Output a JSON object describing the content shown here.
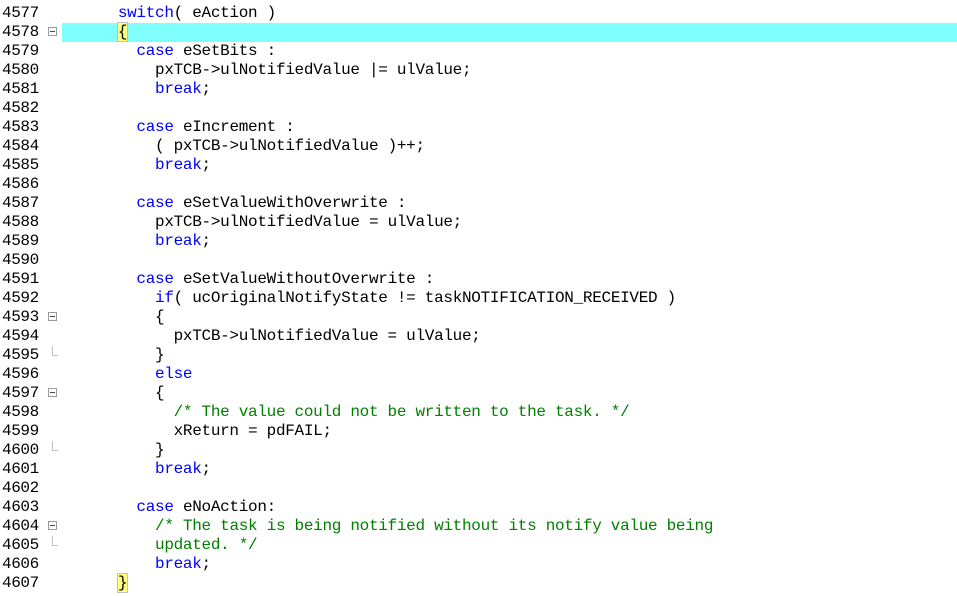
{
  "editor": {
    "highlight_color": "#80ffff",
    "lines": [
      {
        "num": "4577",
        "indent": "      ",
        "parts": [
          [
            "kw",
            "switch"
          ],
          [
            "",
            "( eAction )"
          ]
        ],
        "fold": "line"
      },
      {
        "num": "4578",
        "indent": "      ",
        "parts": [
          [
            "brace",
            "{"
          ]
        ],
        "fold": "box",
        "highlight": true
      },
      {
        "num": "4579",
        "indent": "        ",
        "parts": [
          [
            "kw",
            "case"
          ],
          [
            "",
            " eSetBits :"
          ]
        ],
        "fold": "line"
      },
      {
        "num": "4580",
        "indent": "          ",
        "parts": [
          [
            "",
            "pxTCB->ulNotifiedValue |= ulValue;"
          ]
        ],
        "fold": "line"
      },
      {
        "num": "4581",
        "indent": "          ",
        "parts": [
          [
            "kw",
            "break"
          ],
          [
            "",
            ";"
          ]
        ],
        "fold": "line"
      },
      {
        "num": "4582",
        "indent": "",
        "parts": [],
        "fold": "line"
      },
      {
        "num": "4583",
        "indent": "        ",
        "parts": [
          [
            "kw",
            "case"
          ],
          [
            "",
            " eIncrement :"
          ]
        ],
        "fold": "line"
      },
      {
        "num": "4584",
        "indent": "          ",
        "parts": [
          [
            "",
            "( pxTCB->ulNotifiedValue )++;"
          ]
        ],
        "fold": "line"
      },
      {
        "num": "4585",
        "indent": "          ",
        "parts": [
          [
            "kw",
            "break"
          ],
          [
            "",
            ";"
          ]
        ],
        "fold": "line"
      },
      {
        "num": "4586",
        "indent": "",
        "parts": [],
        "fold": "line"
      },
      {
        "num": "4587",
        "indent": "        ",
        "parts": [
          [
            "kw",
            "case"
          ],
          [
            "",
            " eSetValueWithOverwrite :"
          ]
        ],
        "fold": "line"
      },
      {
        "num": "4588",
        "indent": "          ",
        "parts": [
          [
            "",
            "pxTCB->ulNotifiedValue = ulValue;"
          ]
        ],
        "fold": "line"
      },
      {
        "num": "4589",
        "indent": "          ",
        "parts": [
          [
            "kw",
            "break"
          ],
          [
            "",
            ";"
          ]
        ],
        "fold": "line"
      },
      {
        "num": "4590",
        "indent": "",
        "parts": [],
        "fold": "line"
      },
      {
        "num": "4591",
        "indent": "        ",
        "parts": [
          [
            "kw",
            "case"
          ],
          [
            "",
            " eSetValueWithoutOverwrite :"
          ]
        ],
        "fold": "line"
      },
      {
        "num": "4592",
        "indent": "          ",
        "parts": [
          [
            "kw",
            "if"
          ],
          [
            "",
            "( ucOriginalNotifyState != taskNOTIFICATION_RECEIVED )"
          ]
        ],
        "fold": "line"
      },
      {
        "num": "4593",
        "indent": "          ",
        "parts": [
          [
            "",
            "{"
          ]
        ],
        "fold": "box"
      },
      {
        "num": "4594",
        "indent": "            ",
        "parts": [
          [
            "",
            "pxTCB->ulNotifiedValue = ulValue;"
          ]
        ],
        "fold": "line"
      },
      {
        "num": "4595",
        "indent": "          ",
        "parts": [
          [
            "",
            "}"
          ]
        ],
        "fold": "end"
      },
      {
        "num": "4596",
        "indent": "          ",
        "parts": [
          [
            "kw",
            "else"
          ]
        ],
        "fold": "line"
      },
      {
        "num": "4597",
        "indent": "          ",
        "parts": [
          [
            "",
            "{"
          ]
        ],
        "fold": "box"
      },
      {
        "num": "4598",
        "indent": "            ",
        "parts": [
          [
            "cm",
            "/* The value could not be written to the task. */"
          ]
        ],
        "fold": "line"
      },
      {
        "num": "4599",
        "indent": "            ",
        "parts": [
          [
            "",
            "xReturn = pdFAIL;"
          ]
        ],
        "fold": "line"
      },
      {
        "num": "4600",
        "indent": "          ",
        "parts": [
          [
            "",
            "}"
          ]
        ],
        "fold": "end"
      },
      {
        "num": "4601",
        "indent": "          ",
        "parts": [
          [
            "kw",
            "break"
          ],
          [
            "",
            ";"
          ]
        ],
        "fold": "line"
      },
      {
        "num": "4602",
        "indent": "",
        "parts": [],
        "fold": "line"
      },
      {
        "num": "4603",
        "indent": "        ",
        "parts": [
          [
            "kw",
            "case"
          ],
          [
            "",
            " eNoAction:"
          ]
        ],
        "fold": "line"
      },
      {
        "num": "4604",
        "indent": "          ",
        "parts": [
          [
            "cm",
            "/* The task is being notified without its notify value being"
          ]
        ],
        "fold": "box"
      },
      {
        "num": "4605",
        "indent": "          ",
        "parts": [
          [
            "cm",
            "updated. */"
          ]
        ],
        "fold": "end"
      },
      {
        "num": "4606",
        "indent": "          ",
        "parts": [
          [
            "kw",
            "break"
          ],
          [
            "",
            ";"
          ]
        ],
        "fold": "line"
      },
      {
        "num": "4607",
        "indent": "      ",
        "parts": [
          [
            "brace",
            "}"
          ]
        ],
        "fold": "line"
      }
    ]
  }
}
